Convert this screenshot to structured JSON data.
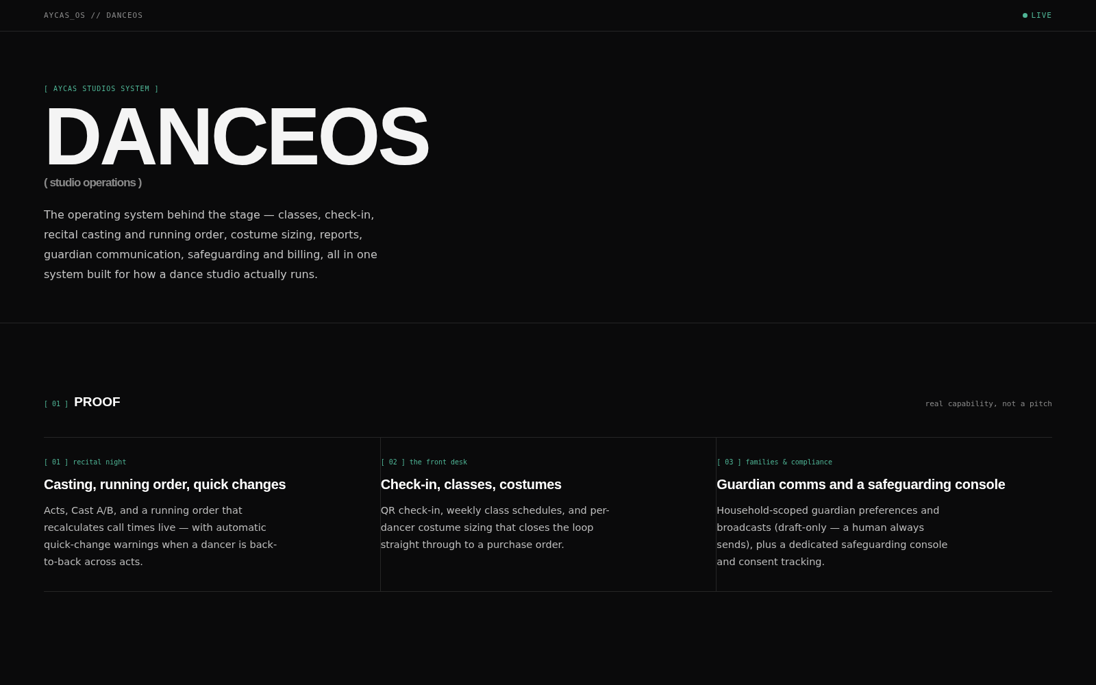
{
  "topbar": {
    "breadcrumb": "AYCAS_OS // DANCEOS",
    "status": {
      "label": "LIVE",
      "live": true
    }
  },
  "hero": {
    "eyebrow": "[ AYCAS STUDIOS SYSTEM ]",
    "title": "DANCEOS",
    "subtitle": "( studio operations )",
    "description": "The operating system behind the stage — classes, check-in, recital casting and running order, costume sizing, reports, guardian communication, safeguarding and billing, all in one system built for how a dance studio actually runs."
  },
  "section": {
    "index": "[ 01 ]",
    "title": "PROOF",
    "note": "real capability, not a pitch",
    "cards": [
      {
        "tag": "[ 01 ] recital night",
        "title": "Casting, running order, quick changes",
        "body": "Acts, Cast A/B, and a running order that recalculates call times live — with automatic quick-change warnings when a dancer is back-to-back across acts."
      },
      {
        "tag": "[ 02 ] the front desk",
        "title": "Check-in, classes, costumes",
        "body": "QR check-in, weekly class schedules, and per-dancer costume sizing that closes the loop straight through to a purchase order."
      },
      {
        "tag": "[ 03 ] families & compliance",
        "title": "Guardian comms and a safeguarding console",
        "body": "Household-scoped guardian preferences and broadcasts (draft-only — a human always sends), plus a dedicated safeguarding console and consent tracking."
      }
    ]
  }
}
